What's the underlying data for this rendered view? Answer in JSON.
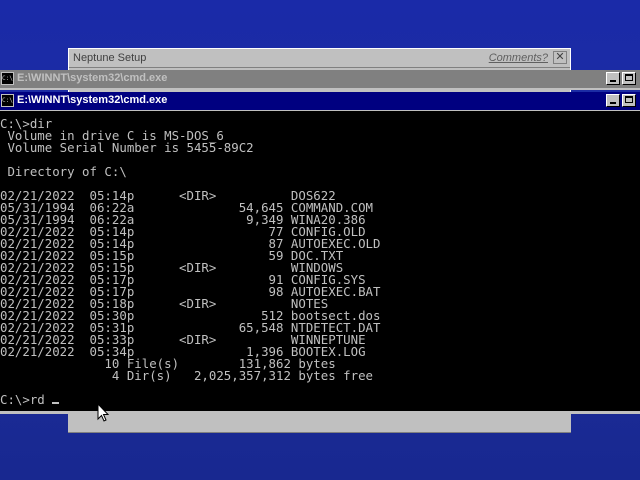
{
  "setup_window": {
    "title": "Neptune Setup",
    "comments_link": "Comments?",
    "close_glyph": "✕"
  },
  "cmd_back": {
    "title": "E:\\WINNT\\system32\\cmd.exe",
    "icon_text": "C:\\"
  },
  "cmd": {
    "title": "E:\\WINNT\\system32\\cmd.exe",
    "icon_text": "C:\\",
    "console_output": "C:\\>dir\n Volume in drive C is MS-DOS_6\n Volume Serial Number is 5455-89C2\n\n Directory of C:\\\n\n02/21/2022  05:14p      <DIR>          DOS622\n05/31/1994  06:22a              54,645 COMMAND.COM\n05/31/1994  06:22a               9,349 WINA20.386\n02/21/2022  05:14p                  77 CONFIG.OLD\n02/21/2022  05:14p                  87 AUTOEXEC.OLD\n02/21/2022  05:15p                  59 DOC.TXT\n02/21/2022  05:15p      <DIR>          WINDOWS\n02/21/2022  05:17p                  91 CONFIG.SYS\n02/21/2022  05:17p                  98 AUTOEXEC.BAT\n02/21/2022  05:18p      <DIR>          NOTES\n02/21/2022  05:30p                 512 bootsect.dos\n02/21/2022  05:31p              65,548 NTDETECT.DAT\n02/21/2022  05:33p      <DIR>          WINNEPTUNE\n02/21/2022  05:34p               1,396 BOOTEX.LOG\n              10 File(s)        131,862 bytes\n               4 Dir(s)   2,025,357,312 bytes free\n\n",
    "prompt_line": "C:\\>rd "
  },
  "colors": {
    "desktop": "#1a2aa8",
    "active_titlebar": "#000080",
    "inactive_titlebar": "#808080",
    "console_bg": "#000000",
    "console_fg": "#c0c0c0"
  },
  "icons": {
    "cmd_icon": "console-icon",
    "minimize": "minimize-icon",
    "maximize": "maximize-icon",
    "close": "close-icon",
    "pointer": "mouse-pointer-icon"
  }
}
